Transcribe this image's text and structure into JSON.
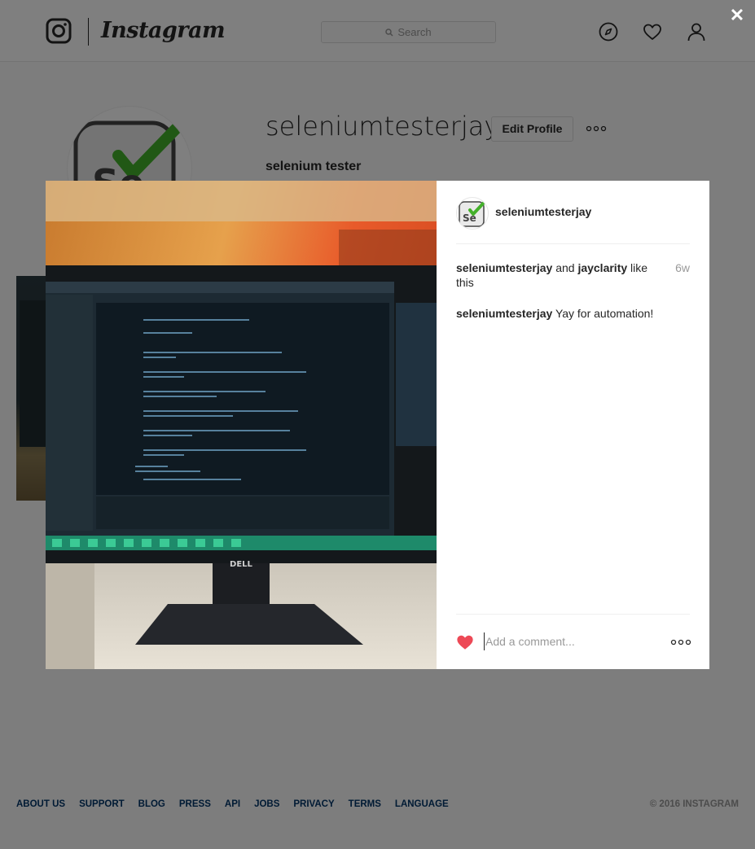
{
  "header": {
    "wordmark": "Instagram",
    "search_placeholder": "Search"
  },
  "profile": {
    "username": "seleniumtesterjay",
    "edit_label": "Edit Profile",
    "full_name": "selenium tester",
    "avatar_text": "Se"
  },
  "post": {
    "username": "seleniumtesterjay",
    "likes": {
      "user1": "seleniumtesterjay",
      "joiner": "and",
      "user2": "jayclarity",
      "suffix": "like this"
    },
    "time_ago": "6w",
    "caption_user": "seleniumtesterjay",
    "caption_text": "Yay for automation!",
    "comment_placeholder": "Add a comment...",
    "photo_brand": "DELL",
    "liked": true
  },
  "overlay": {
    "close_label": "✕"
  },
  "footer": {
    "links": [
      "ABOUT US",
      "SUPPORT",
      "BLOG",
      "PRESS",
      "API",
      "JOBS",
      "PRIVACY",
      "TERMS",
      "LANGUAGE"
    ],
    "copyright": "© 2016 INSTAGRAM"
  },
  "colors": {
    "heart": "#ed4956",
    "selenium_green": "#43b02a",
    "link": "#003569"
  }
}
